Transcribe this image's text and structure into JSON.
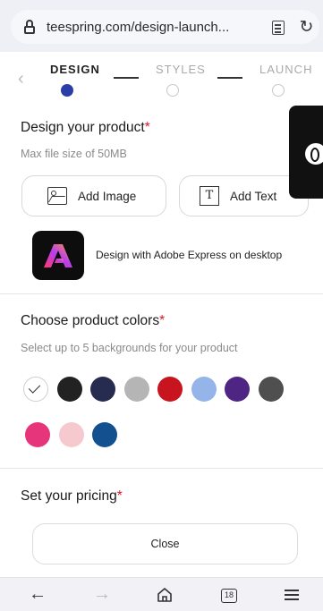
{
  "browser": {
    "url": "teespring.com/design-launch...",
    "tab_count": "18"
  },
  "stepper": {
    "steps": [
      "DESIGN",
      "STYLES",
      "LAUNCH"
    ],
    "active": "DESIGN"
  },
  "design": {
    "title": "Design your product",
    "required_mark": "*",
    "subtitle": "Max file size of 50MB",
    "add_image_label": "Add Image",
    "add_text_label": "Add Text",
    "adobe_label": "Design with Adobe Express on desktop"
  },
  "colors": {
    "title": "Choose product colors",
    "required_mark": "*",
    "subtitle": "Select up to 5 backgrounds for your product",
    "swatches": [
      {
        "name": "white",
        "hex": "#ffffff",
        "selected": true
      },
      {
        "name": "black",
        "hex": "#222222",
        "selected": false
      },
      {
        "name": "navy",
        "hex": "#262b50",
        "selected": false
      },
      {
        "name": "light-gray",
        "hex": "#b5b5b5",
        "selected": false
      },
      {
        "name": "red",
        "hex": "#c8141f",
        "selected": false
      },
      {
        "name": "light-blue",
        "hex": "#95b4ea",
        "selected": false
      },
      {
        "name": "purple",
        "hex": "#4f2584",
        "selected": false
      },
      {
        "name": "dark-gray",
        "hex": "#4f4f4f",
        "selected": false
      },
      {
        "name": "pink",
        "hex": "#e6357a",
        "selected": false
      },
      {
        "name": "light-pink",
        "hex": "#f6c9cf",
        "selected": false
      },
      {
        "name": "royal-blue",
        "hex": "#12508f",
        "selected": false
      }
    ]
  },
  "pricing": {
    "title": "Set your pricing",
    "required_mark": "*"
  },
  "close_label": "Close",
  "accent": "#2b3ea8"
}
